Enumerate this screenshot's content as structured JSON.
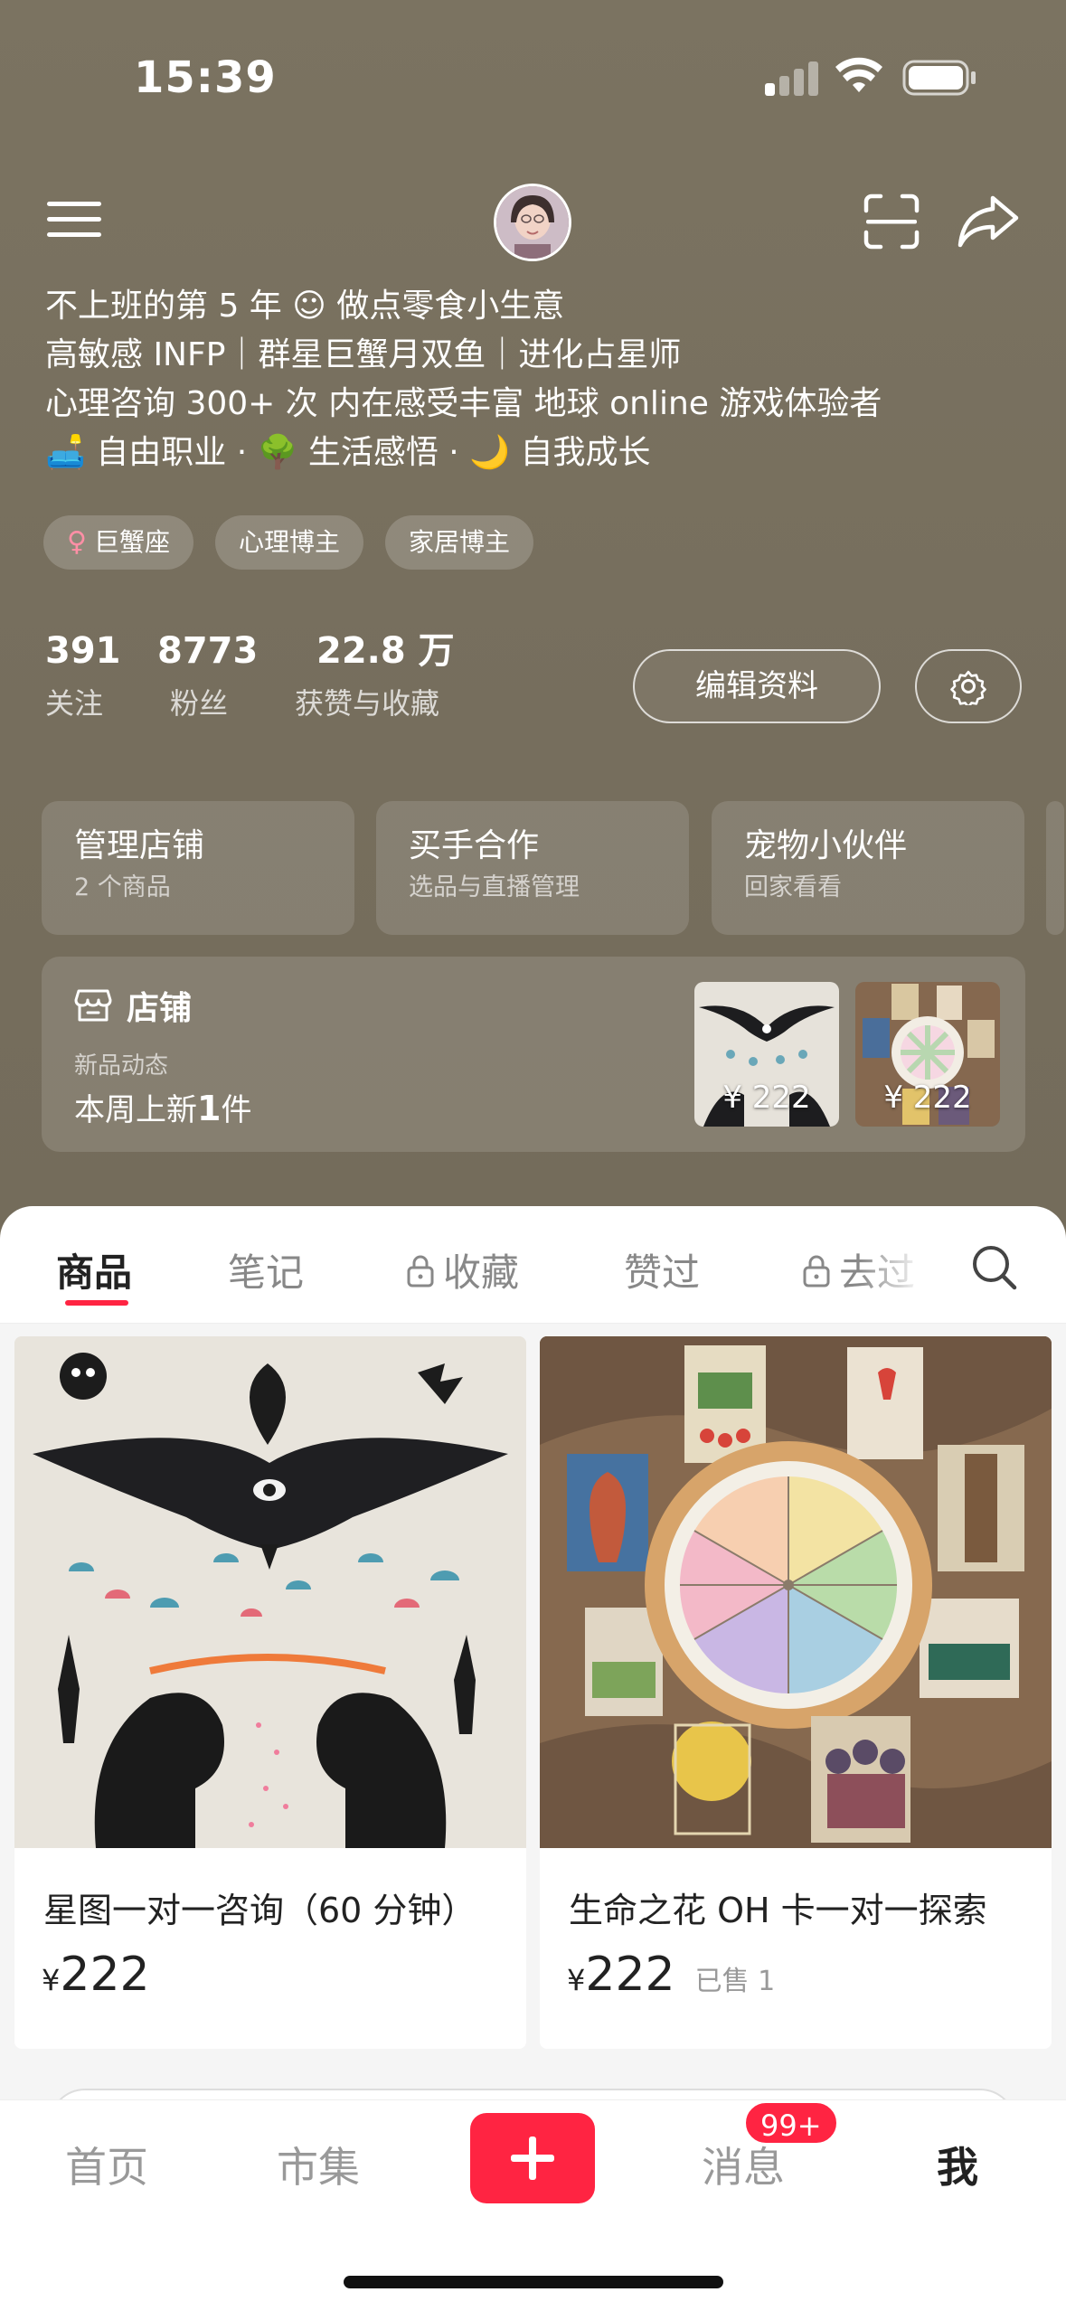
{
  "status_bar": {
    "time": "15:39"
  },
  "profile": {
    "bio_lines": [
      "不上班的第 5 年 ☺ 做点零食小生意",
      "高敏感 INFP｜群星巨蟹月双鱼｜进化占星师",
      "心理咨询 300+ 次 内在感受丰富 地球 online 游戏体验者",
      "🛋️ 自由职业 · 🌳 生活感悟 · 🌙 自我成长"
    ],
    "tags": [
      "巨蟹座",
      "心理博主",
      "家居博主"
    ],
    "stats": {
      "following": {
        "num": "391",
        "label": "关注"
      },
      "followers": {
        "num": "8773",
        "label": "粉丝"
      },
      "likes": {
        "num": "22.8 万",
        "label": "获赞与收藏"
      }
    },
    "edit_label": "编辑资料"
  },
  "feature_cards": [
    {
      "title": "管理店铺",
      "sub": "2 个商品"
    },
    {
      "title": "买手合作",
      "sub": "选品与直播管理"
    },
    {
      "title": "宠物小伙伴",
      "sub": "回家看看"
    }
  ],
  "shop": {
    "title": "店铺",
    "sub": "新品动态",
    "new_prefix": "本周上新",
    "new_count": "1",
    "new_suffix": "件",
    "thumb_prices": [
      "¥ 222",
      "¥ 222"
    ]
  },
  "tabs": [
    "商品",
    "笔记",
    "收藏",
    "赞过",
    "去过"
  ],
  "products": [
    {
      "name": "星图一对一咨询（60 分钟）",
      "currency": "¥",
      "price": "222",
      "sold": ""
    },
    {
      "name": "生命之花 OH 卡一对一探索",
      "currency": "¥",
      "price": "222",
      "sold": "已售 1"
    }
  ],
  "bottom_nav": {
    "home": "首页",
    "market": "市集",
    "messages": "消息",
    "messages_badge": "99+",
    "me": "我"
  },
  "colors": {
    "accent": "#ff2442",
    "header_bg": "#7a7160"
  }
}
